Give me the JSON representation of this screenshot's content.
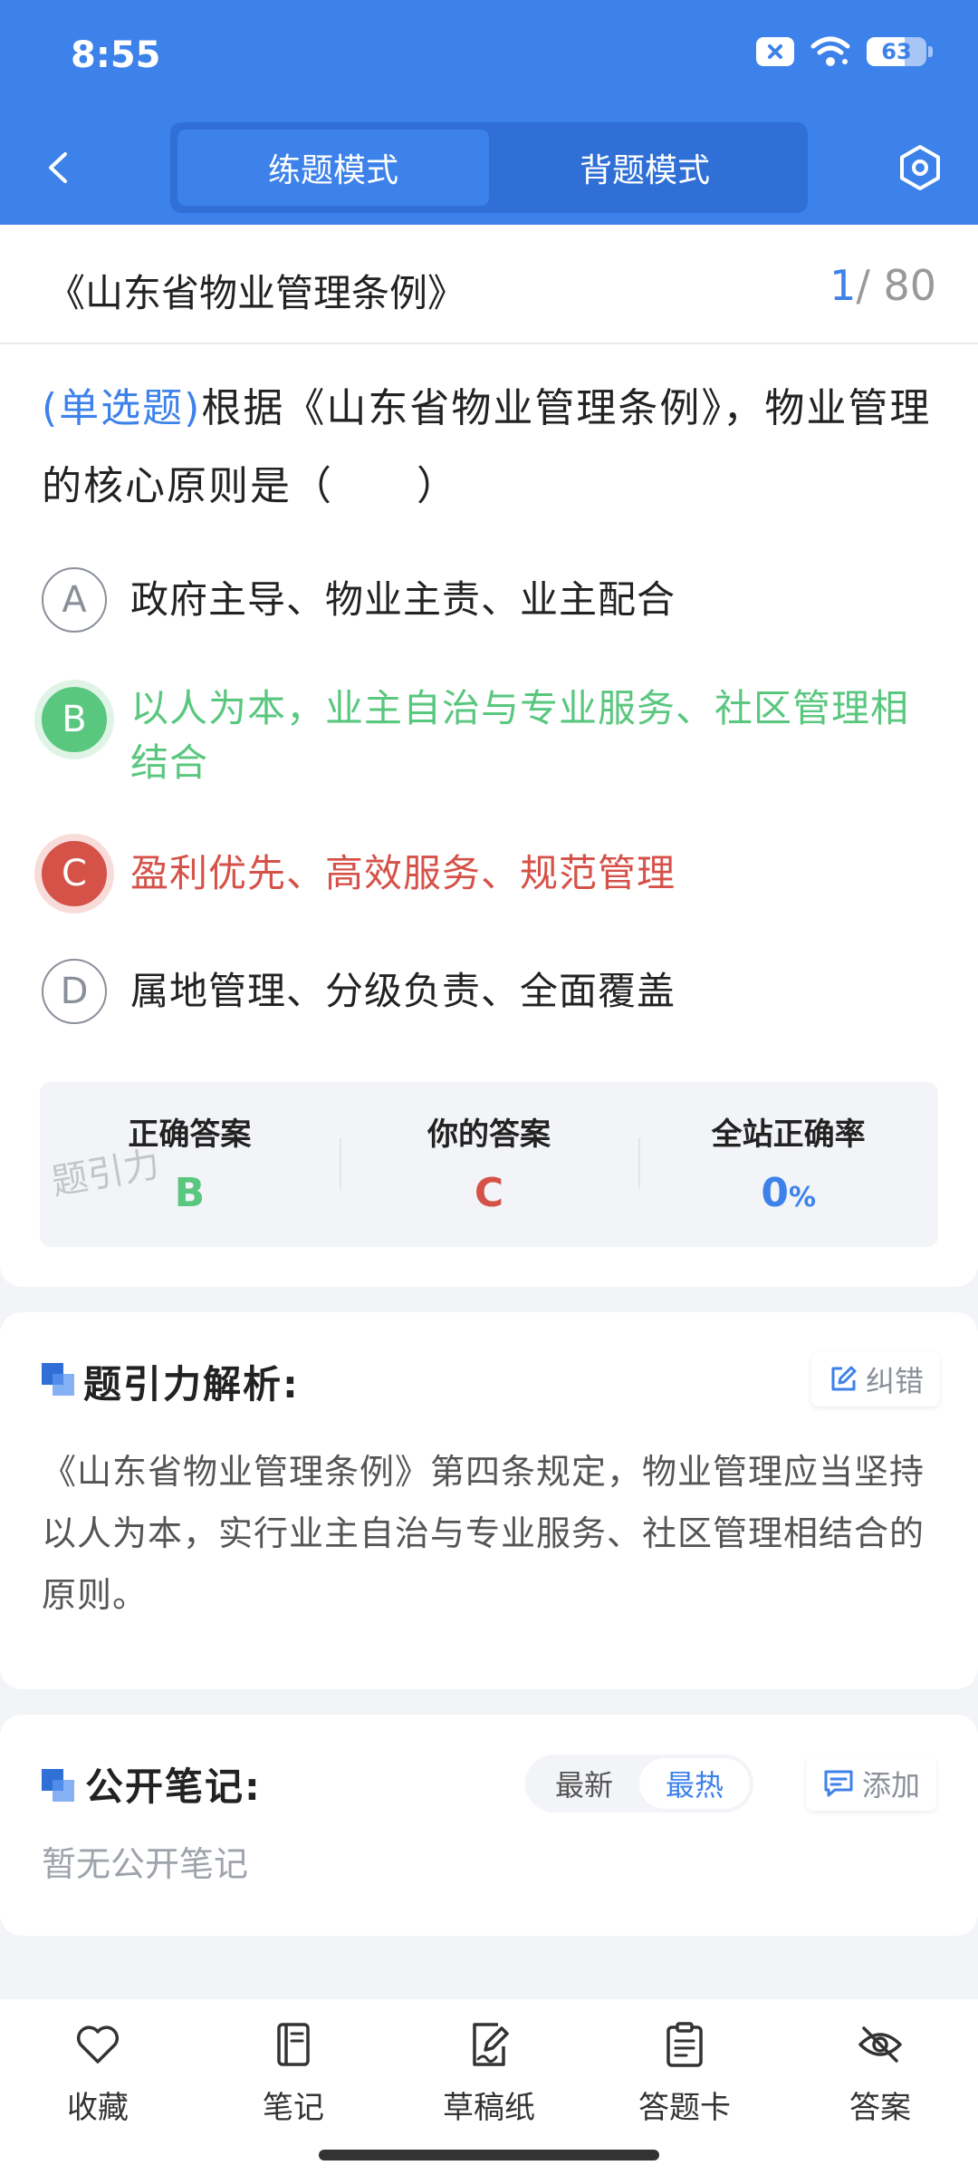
{
  "status_bar": {
    "time": "8:55",
    "battery_level": "63",
    "battery_percent": 63
  },
  "nav": {
    "tabs": [
      {
        "label": "练题模式",
        "active": true
      },
      {
        "label": "背题模式",
        "active": false
      }
    ]
  },
  "paper": {
    "title": "《山东省物业管理条例》",
    "current": "1",
    "total": "/ 80"
  },
  "question": {
    "type": "(单选题)",
    "text": "根据《山东省物业管理条例》，物业管理的核心原则是（　　）",
    "options": [
      {
        "letter": "A",
        "text": "政府主导、物业主责、业主配合",
        "state": "normal"
      },
      {
        "letter": "B",
        "text": "以人为本，业主自治与专业服务、社区管理相结合",
        "state": "correct"
      },
      {
        "letter": "C",
        "text": "盈利优先、高效服务、规范管理",
        "state": "wrong"
      },
      {
        "letter": "D",
        "text": "属地管理、分级负责、全面覆盖",
        "state": "normal"
      }
    ]
  },
  "answer_panel": {
    "correct_label": "正确答案",
    "correct_value": "B",
    "yours_label": "你的答案",
    "yours_value": "C",
    "rate_label": "全站正确率",
    "rate_value": "0",
    "rate_unit": "%",
    "watermark": "题引力"
  },
  "analysis": {
    "title": "题引力解析:",
    "report_label": "纠错",
    "text": "《山东省物业管理条例》第四条规定，物业管理应当坚持以人为本，实行业主自治与专业服务、社区管理相结合的原则。"
  },
  "notes": {
    "title": "公开笔记:",
    "sort_newest": "最新",
    "sort_hottest": "最热",
    "add_label": "添加",
    "empty_text": "暂无公开笔记"
  },
  "bottom_tabs": [
    {
      "label": "收藏",
      "icon": "heart-icon"
    },
    {
      "label": "笔记",
      "icon": "notebook-icon"
    },
    {
      "label": "草稿纸",
      "icon": "draft-icon"
    },
    {
      "label": "答题卡",
      "icon": "answer-card-icon"
    },
    {
      "label": "答案",
      "icon": "eye-off-icon"
    }
  ],
  "colors": {
    "primary": "#3d82ea",
    "correct": "#5ac77f",
    "wrong": "#d55249"
  }
}
